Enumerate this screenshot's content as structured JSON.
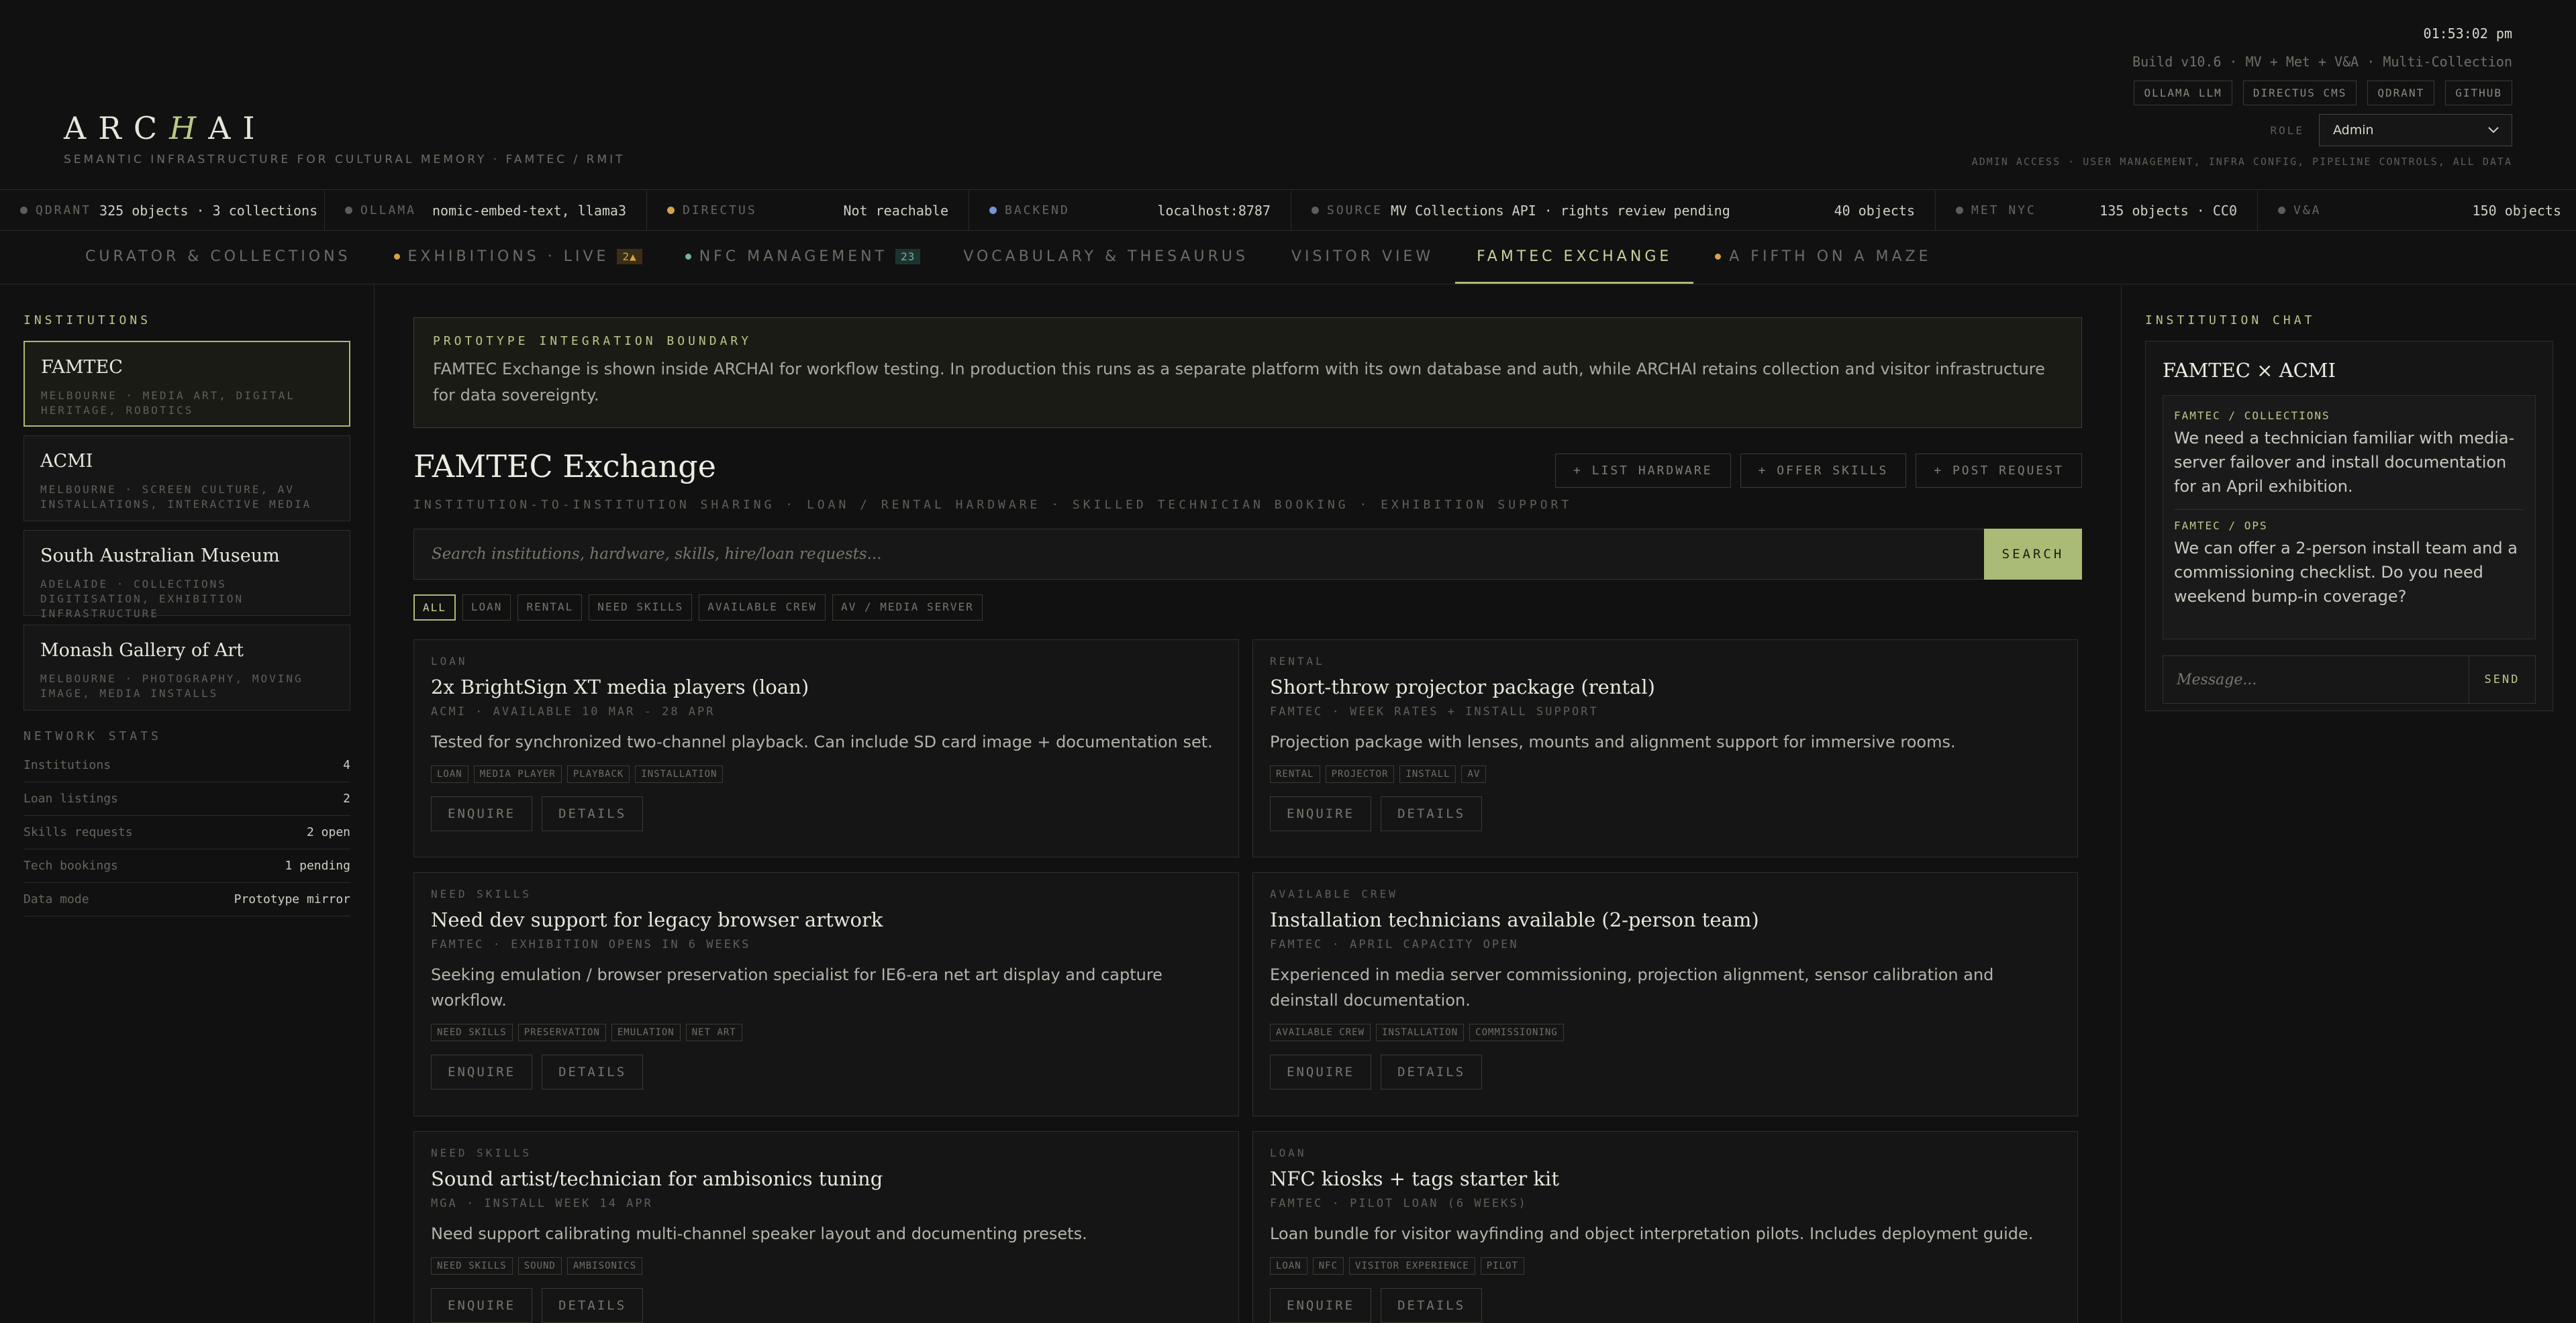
{
  "header": {
    "logo_pre": "ARC",
    "logo_accent": "H",
    "logo_post": "AI",
    "tagline": "SEMANTIC INFRASTRUCTURE FOR CULTURAL MEMORY · FAMTEC / RMIT",
    "clock": "01:53:02 pm",
    "build": "Build v10.6 · MV + Met + V&A · Multi-Collection",
    "links": [
      "OLLAMA LLM",
      "DIRECTUS CMS",
      "QDRANT",
      "GITHUB"
    ],
    "role_label": "ROLE",
    "role_value": "Admin",
    "role_hint": "ADMIN ACCESS · USER MANAGEMENT, INFRA CONFIG, PIPELINE CONTROLS, ALL DATA"
  },
  "status": [
    {
      "label": "QDRANT",
      "value": "325 objects · 3 collections",
      "dot": "#5e5e58"
    },
    {
      "label": "OLLAMA",
      "value": "nomic-embed-text, llama3",
      "dot": "#5e5e58"
    },
    {
      "label": "DIRECTUS",
      "value": "Not reachable",
      "dot": "#d4a24a"
    },
    {
      "label": "BACKEND",
      "value": "localhost:8787",
      "dot": "#7d8fd6"
    },
    {
      "label": "SOURCE",
      "value_a": "MV Collections API · rights review pending",
      "value_b": "40 objects",
      "dot": "#5e5e58"
    },
    {
      "label": "MET NYC",
      "value": "135 objects · CC0",
      "dot": "#5e5e58"
    },
    {
      "label": "V&A",
      "value": "150 objects",
      "dot": "#5e5e58"
    }
  ],
  "tabs": [
    {
      "label": "CURATOR & COLLECTIONS"
    },
    {
      "label": "EXHIBITIONS · LIVE",
      "badge": "2▲",
      "dot": "#d4a24a"
    },
    {
      "label": "NFC MANAGEMENT",
      "badge": "23",
      "dot": "#6fb3a6"
    },
    {
      "label": "VOCABULARY & THESAURUS"
    },
    {
      "label": "VISITOR VIEW"
    },
    {
      "label": "FAMTEC EXCHANGE",
      "active": true
    },
    {
      "label": "A FIFTH ON A MAZE",
      "dot": "#d4a24a"
    }
  ],
  "sidebar": {
    "title": "INSTITUTIONS",
    "institutions": [
      {
        "name": "FAMTEC",
        "sub": "MELBOURNE · MEDIA ART, DIGITAL HERITAGE, ROBOTICS"
      },
      {
        "name": "ACMI",
        "sub": "MELBOURNE · SCREEN CULTURE, AV INSTALLATIONS, INTERACTIVE MEDIA"
      },
      {
        "name": "South Australian Museum",
        "sub": "ADELAIDE · COLLECTIONS DIGITISATION, EXHIBITION INFRASTRUCTURE"
      },
      {
        "name": "Monash Gallery of Art",
        "sub": "MELBOURNE · PHOTOGRAPHY, MOVING IMAGE, MEDIA INSTALLS"
      }
    ],
    "network_title": "NETWORK STATS",
    "stats": [
      {
        "label": "Institutions",
        "value": "4"
      },
      {
        "label": "Loan listings",
        "value": "2"
      },
      {
        "label": "Skills requests",
        "value": "2 open"
      },
      {
        "label": "Tech bookings",
        "value": "1 pending"
      },
      {
        "label": "Data mode",
        "value": "Prototype mirror"
      }
    ]
  },
  "main": {
    "notice_title": "PROTOTYPE INTEGRATION BOUNDARY",
    "notice_body": "FAMTEC Exchange is shown inside ARCHAI for workflow testing. In production this runs as a separate platform with its own database and auth, while ARCHAI retains collection and visitor infrastructure for data sovereignty.",
    "title": "FAMTEC Exchange",
    "subtitle": "INSTITUTION-TO-INSTITUTION SHARING · LOAN / RENTAL HARDWARE · SKILLED TECHNICIAN BOOKING · EXHIBITION SUPPORT",
    "actions": [
      "+ LIST HARDWARE",
      "+ OFFER SKILLS",
      "+ POST REQUEST"
    ],
    "search_placeholder": "Search institutions, hardware, skills, hire/loan requests...",
    "search_button": "SEARCH",
    "filters": [
      "ALL",
      "LOAN",
      "RENTAL",
      "NEED SKILLS",
      "AVAILABLE CREW",
      "AV / MEDIA SERVER"
    ],
    "cards": [
      {
        "type": "LOAN",
        "title": "2x BrightSign XT media players (loan)",
        "meta": "ACMI · AVAILABLE 10 MAR - 28 APR",
        "desc": "Tested for synchronized two-channel playback. Can include SD card image + documentation set.",
        "tags": [
          "LOAN",
          "MEDIA PLAYER",
          "PLAYBACK",
          "INSTALLATION"
        ],
        "enquire": "ENQUIRE",
        "details": "DETAILS"
      },
      {
        "type": "RENTAL",
        "title": "Short-throw projector package (rental)",
        "meta": "FAMTEC · WEEK RATES + INSTALL SUPPORT",
        "desc": "Projection package with lenses, mounts and alignment support for immersive rooms.",
        "tags": [
          "RENTAL",
          "PROJECTOR",
          "INSTALL",
          "AV"
        ],
        "enquire": "ENQUIRE",
        "details": "DETAILS"
      },
      {
        "type": "NEED SKILLS",
        "title": "Need dev support for legacy browser artwork",
        "meta": "FAMTEC · EXHIBITION OPENS IN 6 WEEKS",
        "desc": "Seeking emulation / browser preservation specialist for IE6-era net art display and capture workflow.",
        "tags": [
          "NEED SKILLS",
          "PRESERVATION",
          "EMULATION",
          "NET ART"
        ],
        "enquire": "ENQUIRE",
        "details": "DETAILS"
      },
      {
        "type": "AVAILABLE CREW",
        "title": "Installation technicians available (2-person team)",
        "meta": "FAMTEC · APRIL CAPACITY OPEN",
        "desc": "Experienced in media server commissioning, projection alignment, sensor calibration and deinstall documentation.",
        "tags": [
          "AVAILABLE CREW",
          "INSTALLATION",
          "COMMISSIONING"
        ],
        "enquire": "ENQUIRE",
        "details": "DETAILS"
      },
      {
        "type": "NEED SKILLS",
        "title": "Sound artist/technician for ambisonics tuning",
        "meta": "MGA · INSTALL WEEK 14 APR",
        "desc": "Need support calibrating multi-channel speaker layout and documenting presets.",
        "tags": [
          "NEED SKILLS",
          "SOUND",
          "AMBISONICS"
        ],
        "enquire": "ENQUIRE",
        "details": "DETAILS"
      },
      {
        "type": "LOAN",
        "title": "NFC kiosks + tags starter kit",
        "meta": "FAMTEC · PILOT LOAN (6 WEEKS)",
        "desc": "Loan bundle for visitor wayfinding and object interpretation pilots. Includes deployment guide.",
        "tags": [
          "LOAN",
          "NFC",
          "VISITOR EXPERIENCE",
          "PILOT"
        ],
        "enquire": "ENQUIRE",
        "details": "DETAILS"
      }
    ]
  },
  "chat": {
    "section_title": "INSTITUTION CHAT",
    "title": "FAMTEC × ACMI",
    "messages": [
      {
        "from": "FAMTEC / COLLECTIONS",
        "text": "We need a technician familiar with media-server failover and install documentation for an April exhibition."
      },
      {
        "from": "FAMTEC / OPS",
        "text": "We can offer a 2-person install team and a commissioning checklist. Do you need weekend bump-in coverage?"
      }
    ],
    "input_placeholder": "Message...",
    "send_label": "SEND"
  },
  "colors": {
    "accent": "#a9bb74",
    "background": "#111111",
    "warning": "#d4a24a"
  }
}
